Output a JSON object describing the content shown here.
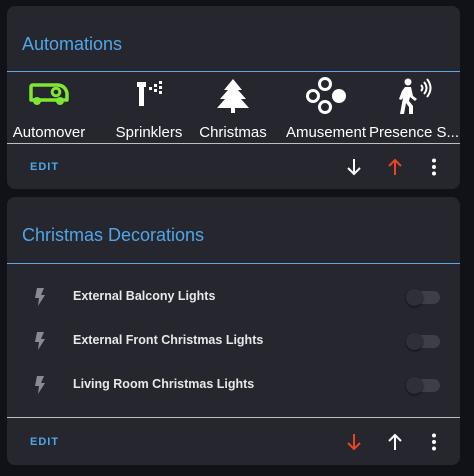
{
  "colors": {
    "page_background": "#111118",
    "card_background": "#26262f",
    "title_blue": "#4fa6e8",
    "automower_green": "#7fe632",
    "arrow_red": "#e8471e",
    "toggle_off": "#3e3e48"
  },
  "automations_card": {
    "title": "Automations",
    "tiles": [
      {
        "label": "Automover",
        "icon": "robot-mower-icon"
      },
      {
        "label": "Sprinklers",
        "icon": "sprinkler-icon"
      },
      {
        "label": "Christmas",
        "icon": "pine-tree-icon"
      },
      {
        "label": "Amusement",
        "icon": "scatter-plot-icon"
      },
      {
        "label": "Presence S...",
        "icon": "motion-sensor-icon"
      }
    ],
    "footer": {
      "edit_label": "EDIT",
      "icons": [
        "arrow-down-icon",
        "arrow-up-icon",
        "more-vertical-icon"
      ]
    }
  },
  "christmas_card": {
    "title": "Christmas Decorations",
    "rows": [
      {
        "label": "External Balcony Lights",
        "icon": "lightning-bolt-icon",
        "on": false
      },
      {
        "label": "External Front Christmas Lights",
        "icon": "lightning-bolt-icon",
        "on": false
      },
      {
        "label": "Living Room Christmas Lights",
        "icon": "lightning-bolt-icon",
        "on": false
      }
    ],
    "footer": {
      "edit_label": "EDIT",
      "icons": [
        "arrow-down-icon",
        "arrow-up-icon",
        "more-vertical-icon"
      ]
    }
  }
}
